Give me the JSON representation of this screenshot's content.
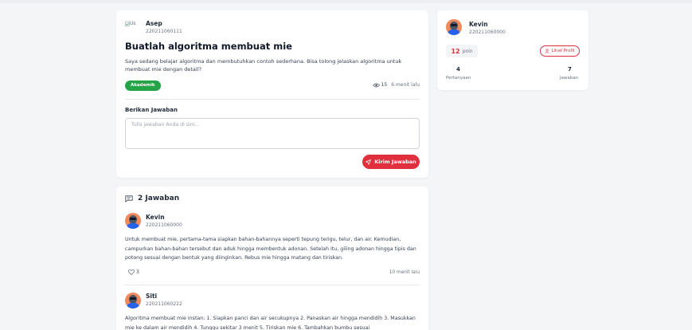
{
  "question": {
    "author_name": "Asep",
    "author_nim": "220211060111",
    "avatar_alt": "Us",
    "title": "Buatlah algoritma membuat mie",
    "body": "Saya sedang belajar algoritma dan membutuhkan contoh sederhana. Bisa tolong jelaskan algoritma untuk membuat mie dengan detail?",
    "category": "Akademik",
    "views": "15",
    "time": "6 menit lalu"
  },
  "answer_form": {
    "label": "Berikan Jawaban",
    "placeholder": "Tulis jawaban Anda di sini...",
    "submit_label": "Kirim Jawaban"
  },
  "profile": {
    "name": "Kevin",
    "nim": "220211060000",
    "points": "12",
    "points_label": "poin",
    "view_profile_label": "Lihat Profil",
    "questions_count": "4",
    "questions_label": "Pertanyaan",
    "answers_count": "7",
    "answers_label": "Jawaban"
  },
  "answers_section": {
    "count_label": "2 Jawaban",
    "answers": [
      {
        "name": "Kevin",
        "nim": "220211060000",
        "text": "Untuk membuat mie, pertama-tama siapkan bahan-bahannya seperti tepung terigu, telur, dan air. Kemudian, campurkan bahan-bahan tersebut dan aduk hingga membentuk adonan. Setelah itu, giling adonan hingga tipis dan potong sesuai dengan bentuk yang diinginkan. Rebus mie hingga matang dan tiriskan.",
        "likes": "3",
        "time": "10 menit lalu"
      },
      {
        "name": "Siti",
        "nim": "220211060222",
        "text": "Algoritma membuat mie instan: 1. Siapkan panci dan air secukupnya 2. Panaskan air hingga mendidih 3. Masukkan mie ke dalam air mendidih 4. Tunggu sekitar 3 menit 5. Tiriskan mie 6. Tambahkan bumbu sesuai"
      }
    ]
  },
  "colors": {
    "accent": "#e0303d",
    "badge_green": "#22a447",
    "background": "#f4f5f7"
  }
}
